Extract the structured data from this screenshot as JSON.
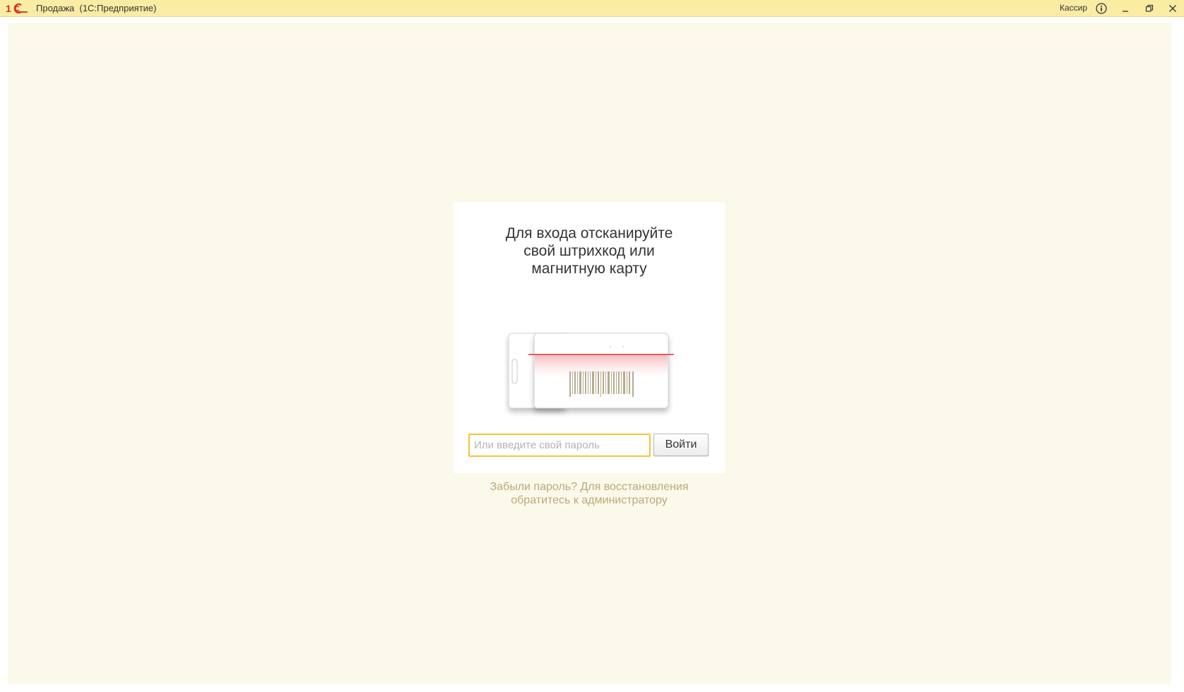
{
  "window": {
    "title": "Продажа  (1С:Предприятие)",
    "user": "Кассир",
    "icons": [
      "1c-logo-icon",
      "info-icon",
      "minimize-icon",
      "restore-icon",
      "close-icon"
    ]
  },
  "login": {
    "heading_line1": "Для входа отсканируйте",
    "heading_line2": "свой штрихкод или",
    "heading_line3": "магнитную карту",
    "password_placeholder": "Или введите свой пароль",
    "login_button": "Войти",
    "forgot_line1": "Забыли пароль? Для восстановления",
    "forgot_line2": "обратитесь к администратору"
  },
  "colors": {
    "titlebar": "#fbeca4",
    "workspace": "#fbf9ea",
    "accent_input_border": "#f4c430",
    "scan_line": "#d8343c",
    "hint_text": "#bba97a"
  }
}
